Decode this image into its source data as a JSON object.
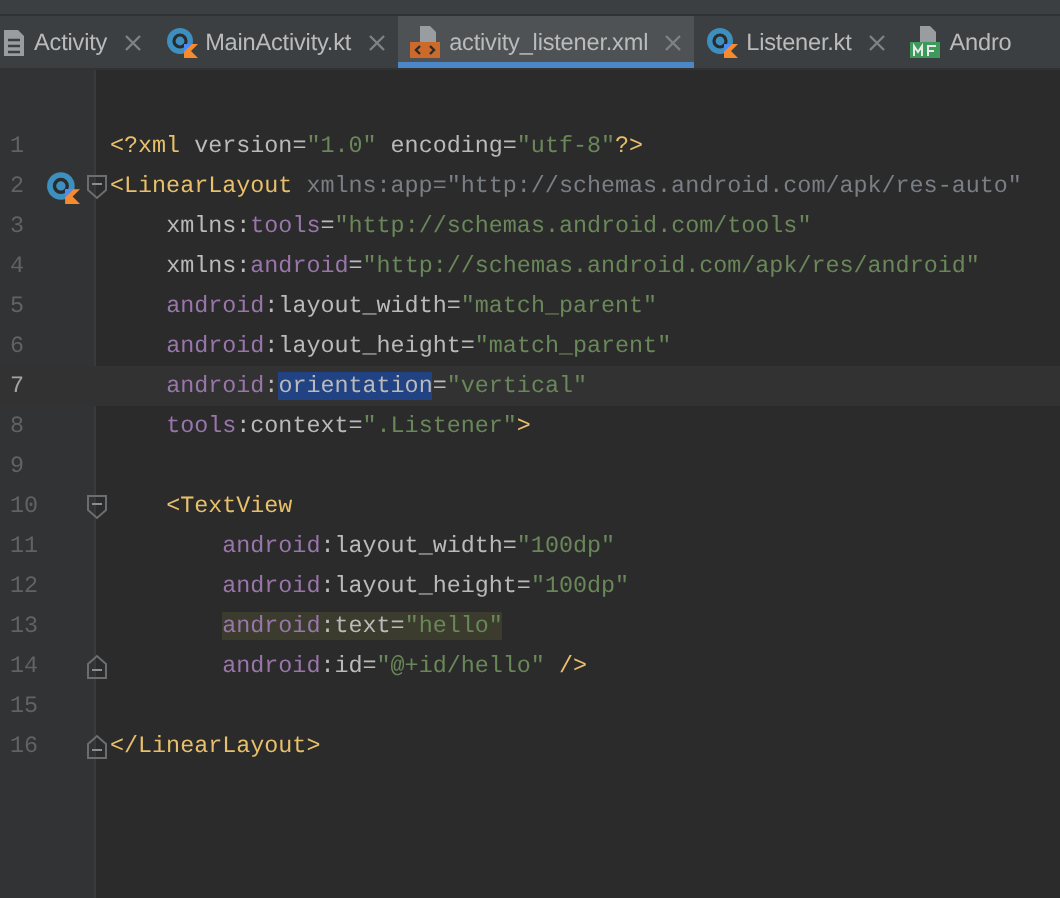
{
  "tabs": [
    {
      "label": "Activity",
      "kind": "file",
      "selected": false,
      "closable": true
    },
    {
      "label": "MainActivity.kt",
      "kind": "kotlin",
      "selected": false,
      "closable": true
    },
    {
      "label": "activity_listener.xml",
      "kind": "xml",
      "selected": true,
      "closable": true
    },
    {
      "label": "Listener.kt",
      "kind": "kotlin",
      "selected": false,
      "closable": true
    },
    {
      "label": "Andro",
      "kind": "manifest",
      "selected": false,
      "closable": false
    }
  ],
  "editor": {
    "lines": [
      {
        "number": "1",
        "kind": "plain",
        "current": false,
        "tokens": [
          {
            "text": "<?xml ",
            "kind": "tag"
          },
          {
            "text": "version=",
            "kind": "attr"
          },
          {
            "text": "\"1.0\" ",
            "kind": "value"
          },
          {
            "text": "encoding=",
            "kind": "attr"
          },
          {
            "text": "\"utf-8\"",
            "kind": "value"
          },
          {
            "text": "?>",
            "kind": "tag"
          }
        ]
      },
      {
        "number": "2",
        "kind": "open",
        "current": false,
        "class_marker": true,
        "tokens": [
          {
            "text": "<LinearLayout ",
            "kind": "tag"
          },
          {
            "text": "xmlns:app=\"http://schemas.android.com/apk/res-auto\"",
            "kind": "unused"
          }
        ]
      },
      {
        "number": "3",
        "kind": "plain",
        "current": false,
        "tokens": [
          {
            "text": "    xmlns:",
            "kind": "attr"
          },
          {
            "text": "tools",
            "kind": "ns"
          },
          {
            "text": "=",
            "kind": "attr"
          },
          {
            "text": "\"http://schemas.android.com/tools\"",
            "kind": "value"
          }
        ]
      },
      {
        "number": "4",
        "kind": "plain",
        "current": false,
        "tokens": [
          {
            "text": "    xmlns:",
            "kind": "attr"
          },
          {
            "text": "android",
            "kind": "ns"
          },
          {
            "text": "=",
            "kind": "attr"
          },
          {
            "text": "\"http://schemas.android.com/apk/res/android\"",
            "kind": "value"
          }
        ]
      },
      {
        "number": "5",
        "kind": "plain",
        "current": false,
        "tokens": [
          {
            "text": "    android",
            "kind": "ns"
          },
          {
            "text": ":layout_width=",
            "kind": "attr"
          },
          {
            "text": "\"match_parent\"",
            "kind": "value"
          }
        ]
      },
      {
        "number": "6",
        "kind": "plain",
        "current": false,
        "tokens": [
          {
            "text": "    android",
            "kind": "ns"
          },
          {
            "text": ":layout_height=",
            "kind": "attr"
          },
          {
            "text": "\"match_parent\"",
            "kind": "value"
          }
        ]
      },
      {
        "number": "7",
        "kind": "plain",
        "current": true,
        "tokens": [
          {
            "text": "    android",
            "kind": "ns"
          },
          {
            "text": ":",
            "kind": "attr"
          },
          {
            "text": "orientation",
            "kind": "attr",
            "selected": true
          },
          {
            "text": "=",
            "kind": "attr"
          },
          {
            "text": "\"vertical\"",
            "kind": "value"
          }
        ]
      },
      {
        "number": "8",
        "kind": "plain",
        "current": false,
        "tokens": [
          {
            "text": "    tools",
            "kind": "ns"
          },
          {
            "text": ":context=",
            "kind": "attr"
          },
          {
            "text": "\".Listener\"",
            "kind": "value"
          },
          {
            "text": ">",
            "kind": "tag"
          }
        ]
      },
      {
        "number": "9",
        "kind": "plain",
        "current": false
      },
      {
        "number": "10",
        "kind": "open",
        "current": false,
        "tokens": [
          {
            "text": "    <TextView",
            "kind": "tag"
          }
        ]
      },
      {
        "number": "11",
        "kind": "plain",
        "current": false,
        "tokens": [
          {
            "text": "        android",
            "kind": "ns"
          },
          {
            "text": ":layout_width=",
            "kind": "attr"
          },
          {
            "text": "\"100dp\"",
            "kind": "value"
          }
        ]
      },
      {
        "number": "12",
        "kind": "plain",
        "current": false,
        "tokens": [
          {
            "text": "        android",
            "kind": "ns"
          },
          {
            "text": ":layout_height=",
            "kind": "attr"
          },
          {
            "text": "\"100dp\"",
            "kind": "value"
          }
        ]
      },
      {
        "number": "13",
        "kind": "plain",
        "current": false,
        "tokens": [
          {
            "text": "        android",
            "kind": "ns",
            "highlighted": true
          },
          {
            "text": ":text=",
            "kind": "attr",
            "highlighted": true
          },
          {
            "text": "\"hello\"",
            "kind": "value",
            "highlighted": true
          }
        ]
      },
      {
        "number": "14",
        "kind": "close",
        "current": false,
        "tokens": [
          {
            "text": "        android",
            "kind": "ns"
          },
          {
            "text": ":id=",
            "kind": "attr"
          },
          {
            "text": "\"@+id/hello\" ",
            "kind": "value"
          },
          {
            "text": "/>",
            "kind": "tag"
          }
        ]
      },
      {
        "number": "15",
        "kind": "plain",
        "current": false
      },
      {
        "number": "16",
        "kind": "close",
        "current": false,
        "tokens": [
          {
            "text": "</LinearLayout>",
            "kind": "tag"
          }
        ]
      }
    ]
  }
}
